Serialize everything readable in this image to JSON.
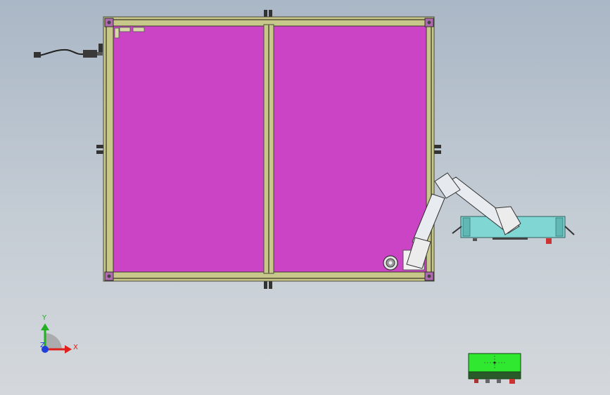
{
  "triad": {
    "x_label": "X",
    "y_label": "Y",
    "z_label": "Z",
    "colors": {
      "x": "#e0201a",
      "y": "#22b022",
      "z": "#1f3fd8"
    }
  },
  "colors": {
    "background_top": "#aab7c6",
    "background_bottom": "#d4d8dc",
    "panel_fill": "#cc44c6",
    "frame_profile": "#c8c88a",
    "frame_dark": "#4a4a3a",
    "robot_arm": "#e8ebef",
    "robot_base": "#7fd6d2",
    "sensor_box": "#2fe82f",
    "corner_bracket": "#b06ab0"
  },
  "icons": {
    "frame": "aluminum-frame-icon",
    "robot": "robot-arm-icon",
    "cable": "power-cable-icon",
    "sensor": "sensor-module-icon",
    "triad": "coordinate-triad-icon"
  }
}
